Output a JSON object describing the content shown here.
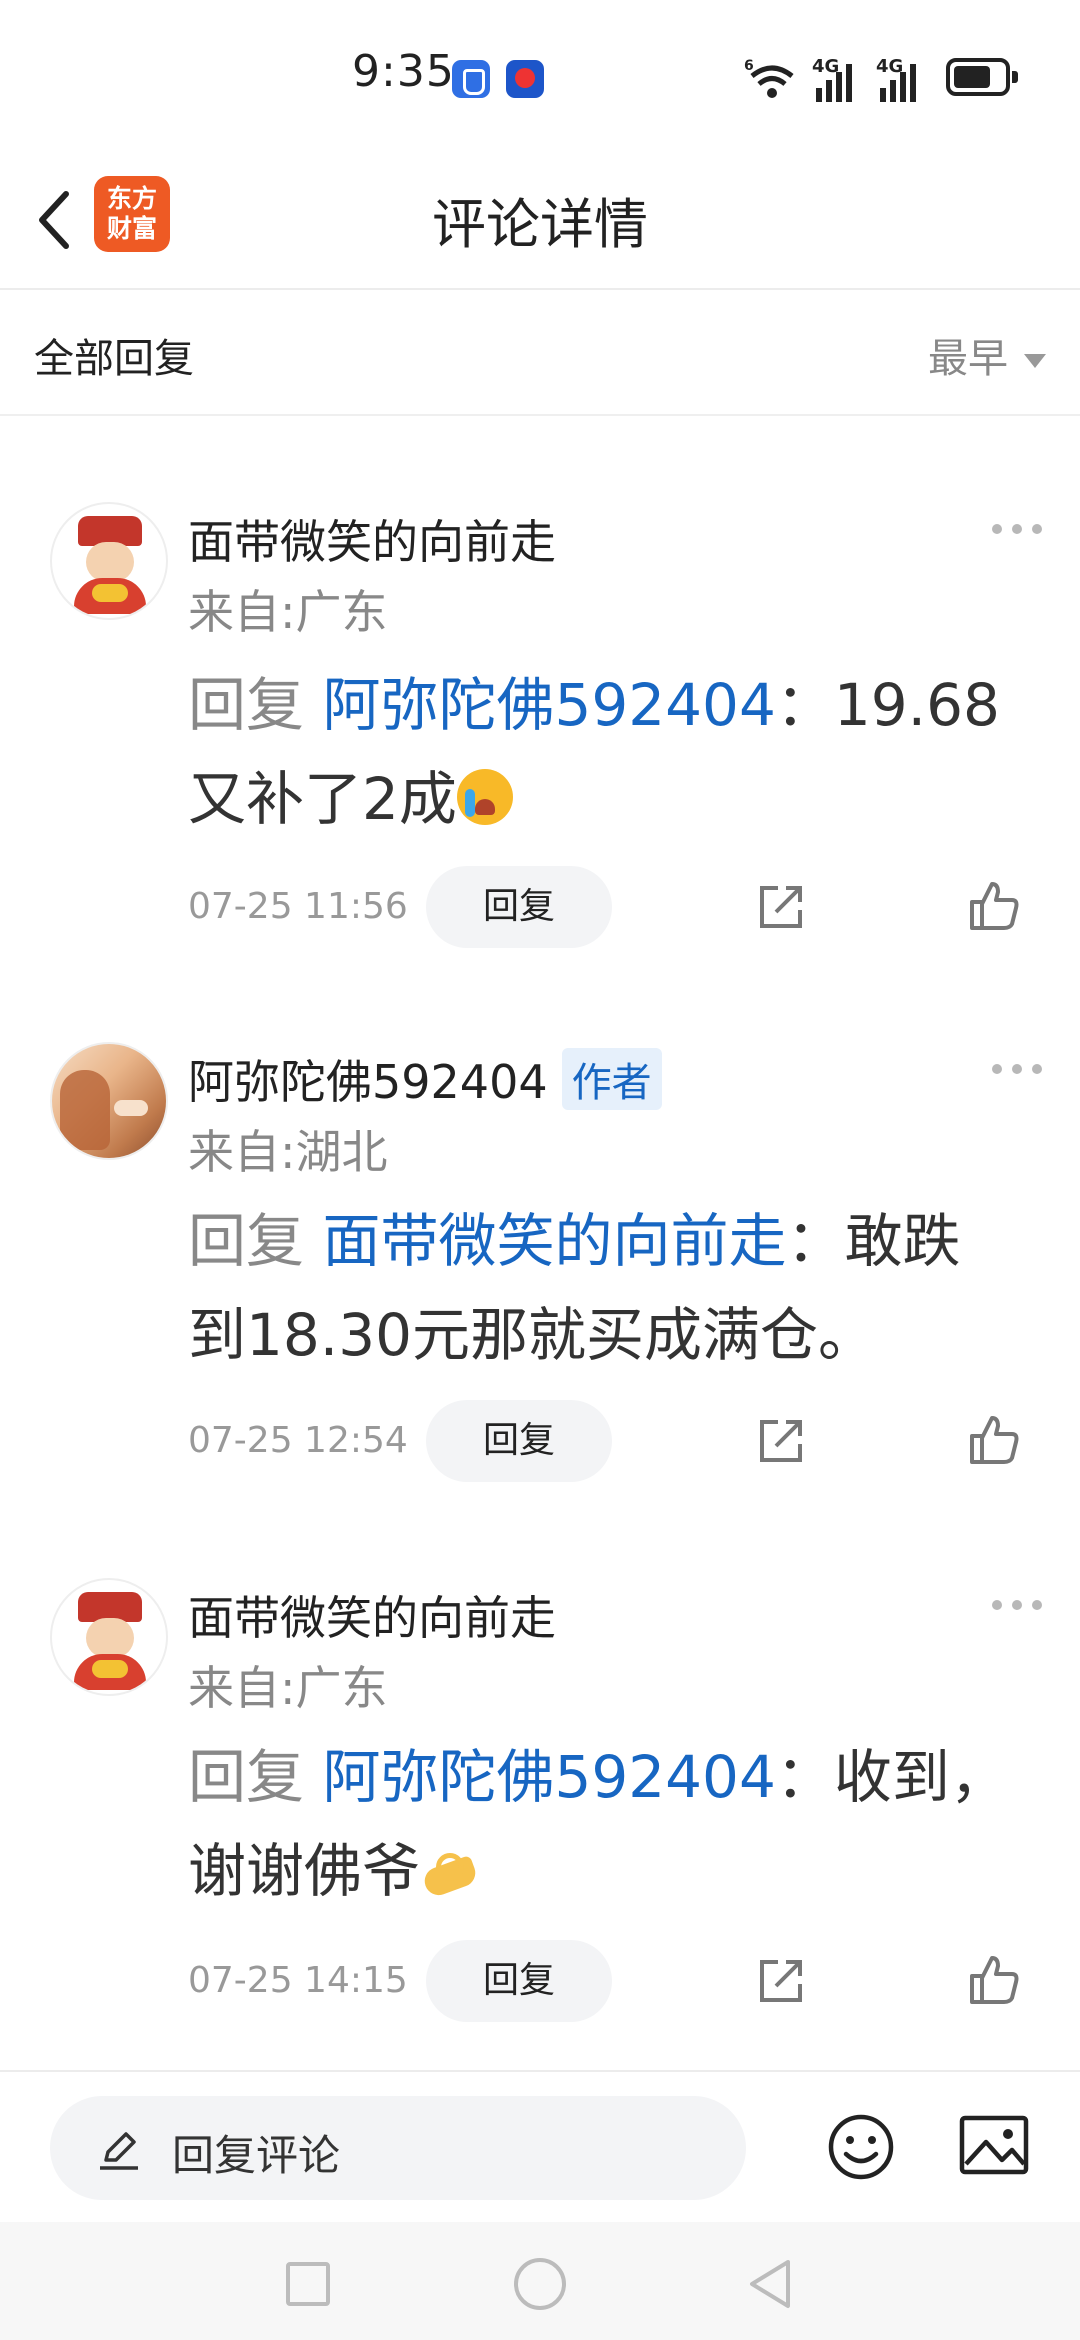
{
  "status_bar": {
    "time": "9:35",
    "network_1": "4G",
    "network_2": "4G",
    "wifi_tag": "6"
  },
  "header": {
    "title": "评论详情",
    "logo_line1": "东方",
    "logo_line2": "财富",
    "brand_color": "#ee5a24"
  },
  "sort_bar": {
    "left_label": "全部回复",
    "sort_label": "最早"
  },
  "comments": [
    {
      "name": "面带微笑的向前走",
      "is_author": false,
      "location": "来自:广东",
      "reply_word": "回复",
      "mention": "阿弥陀佛592404",
      "text": "：19.68又补了2成",
      "emoji": "loudly-crying-face",
      "timestamp": "07-25 11:56",
      "reply_label": "回复"
    },
    {
      "name": "阿弥陀佛592404",
      "is_author": true,
      "author_tag": "作者",
      "location": "来自:湖北",
      "reply_word": "回复",
      "mention": "面带微笑的向前走",
      "text": "：敢跌到18.30元那就买成满仓。",
      "timestamp": "07-25 12:54",
      "reply_label": "回复"
    },
    {
      "name": "面带微笑的向前走",
      "is_author": false,
      "location": "来自:广东",
      "reply_word": "回复",
      "mention": "阿弥陀佛592404",
      "text": "：收到，谢谢佛爷",
      "emoji": "ok-hand",
      "timestamp": "07-25 14:15",
      "reply_label": "回复"
    }
  ],
  "bottom_bar": {
    "input_placeholder": "回复评论"
  },
  "colors": {
    "mention": "#1766c2",
    "secondary_text": "#888888",
    "pill_bg": "#f3f4f6"
  }
}
